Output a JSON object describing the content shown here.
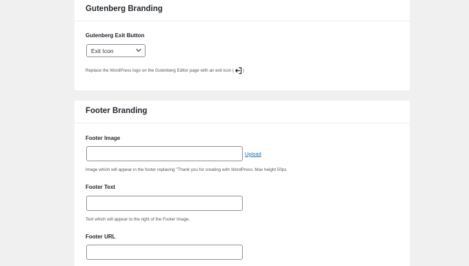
{
  "gutenberg_branding": {
    "title": "Gutenberg Branding",
    "exit_button": {
      "label": "Gutenberg Exit Button",
      "selected": "Exit Icon",
      "help_before": "Replace the WordPress logo on the Gutenberg Editor page with an exit icon (",
      "help_icon": "exit-arrow-icon",
      "help_after": ")"
    }
  },
  "footer_branding": {
    "title": "Footer Branding",
    "footer_image": {
      "label": "Footer Image",
      "value": "",
      "upload_label": "Upload",
      "help": "Image which will appear in the footer replacing \"Thank you for creating with WordPress. Max height 50px"
    },
    "footer_text": {
      "label": "Footer Text",
      "value": "",
      "help": "Text which will appear to the right of the Footer Image."
    },
    "footer_url": {
      "label": "Footer URL",
      "value": ""
    }
  },
  "colors": {
    "background": "#f0f0f1",
    "panel": "#ffffff",
    "link": "#2271b1",
    "input_border": "#8c8f94"
  }
}
